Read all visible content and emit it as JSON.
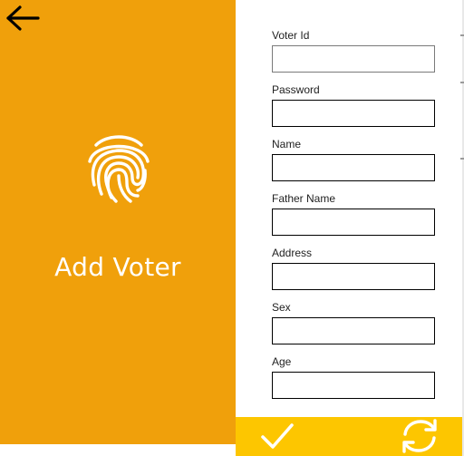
{
  "header": {
    "title": "Add Voter",
    "back_icon": "arrow-left-icon"
  },
  "branding": {
    "icon": "fingerprint-icon",
    "accent_color": "#f0a00b",
    "action_bar_color": "#fdc600"
  },
  "form": {
    "fields": [
      {
        "label": "Voter Id",
        "value": ""
      },
      {
        "label": "Password",
        "value": ""
      },
      {
        "label": "Name",
        "value": ""
      },
      {
        "label": "Father Name",
        "value": ""
      },
      {
        "label": "Address",
        "value": ""
      },
      {
        "label": "Sex",
        "value": ""
      },
      {
        "label": "Age",
        "value": ""
      }
    ]
  },
  "actions": {
    "confirm_icon": "checkmark-icon",
    "refresh_icon": "refresh-icon"
  }
}
